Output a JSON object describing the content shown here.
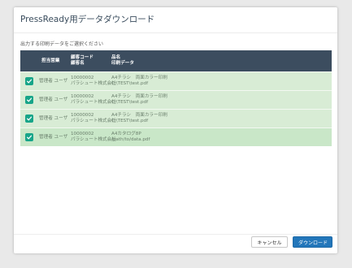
{
  "dialog": {
    "title": "PressReady用データダウンロード",
    "instruction": "出力する印刷データをご選択ください"
  },
  "table": {
    "headers": {
      "staff": "担当営業",
      "customer_code": "顧客コード",
      "customer_name": "顧客名",
      "product": "品名",
      "print_data": "印刷データ"
    },
    "rows": [
      {
        "checked": true,
        "staff": "管理者 ユーザ",
        "customer_code": "10000002",
        "customer_name": "パラシュート株式会社",
        "product": "A4チラシ　両面カラー印刷",
        "print_data": "C:\\TEST\\test.pdf"
      },
      {
        "checked": true,
        "staff": "管理者 ユーザ",
        "customer_code": "10000002",
        "customer_name": "パラシュート株式会社",
        "product": "A4チラシ　両面カラー印刷",
        "print_data": "C:\\TEST\\test.pdf"
      },
      {
        "checked": true,
        "staff": "管理者 ユーザ",
        "customer_code": "10000002",
        "customer_name": "パラシュート株式会社",
        "product": "A4チラシ　両面カラー印刷",
        "print_data": "C:\\TEST\\test.pdf"
      },
      {
        "checked": true,
        "staff": "管理者 ユーザ",
        "customer_code": "10000002",
        "customer_name": "パラシュート株式会社",
        "product": "A4カタログ8P",
        "print_data": "/path/to/data.pdf"
      }
    ]
  },
  "footer": {
    "cancel_label": "キャンセル",
    "download_label": "ダウンロード"
  },
  "colors": {
    "header_bg": "#3c4d5f",
    "row_bg": "#d8ecd5",
    "row_hover_bg": "#c9e7c8",
    "checkbox": "#17a589",
    "primary_button": "#2276ba"
  }
}
